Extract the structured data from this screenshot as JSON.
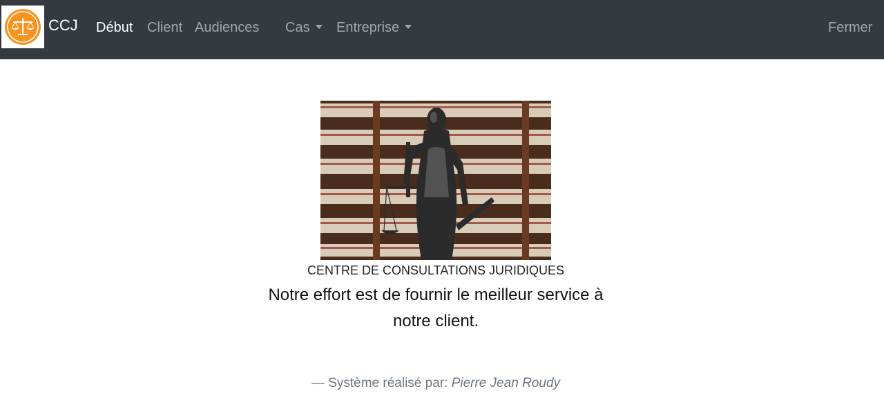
{
  "navbar": {
    "brand": "CCJ",
    "logo_icon": "scales-of-justice-icon",
    "links": [
      "Début",
      "Client",
      "Audiences"
    ],
    "dropdowns": [
      "Cas",
      "Entreprise"
    ],
    "logout": "Fermer",
    "colors": {
      "background": "#343a40",
      "active": "#ffffff",
      "inactive": "rgba(255,255,255,0.55)",
      "logo_orange": "#f7931e"
    }
  },
  "main": {
    "hero_image": "lady-justice-statue-library",
    "heading": "CENTRE DE CONSULTATIONS JURIDIQUES",
    "tagline": "Notre effort est de fournir le meilleur service à notre client.",
    "credit_prefix": "— Système réalisé par:",
    "credit_author": "Pierre Jean Roudy"
  }
}
